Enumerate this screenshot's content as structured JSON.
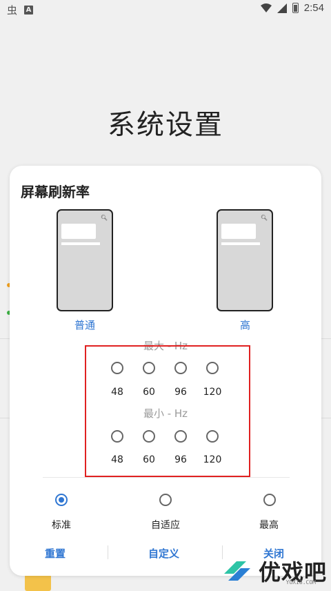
{
  "status_bar": {
    "time": "2:54",
    "left_icon_char": "虫",
    "a_icon": "A"
  },
  "page_title": "系统设置",
  "dialog": {
    "title": "屏幕刷新率",
    "options": [
      {
        "label": "普通"
      },
      {
        "label": "高"
      }
    ],
    "max_label": "最大 - Hz",
    "min_label": "最小 - Hz",
    "max_values": [
      "48",
      "60",
      "96",
      "120"
    ],
    "min_values": [
      "48",
      "60",
      "96",
      "120"
    ],
    "modes": [
      {
        "label": "标准",
        "selected": true
      },
      {
        "label": "自适应",
        "selected": false
      },
      {
        "label": "最高",
        "selected": false
      }
    ],
    "buttons": {
      "reset": "重置",
      "custom": "自定义",
      "close": "关闭"
    }
  },
  "watermark": {
    "text": "优戏吧",
    "sub": "YOXI8.COM"
  },
  "colors": {
    "accent": "#2f76d2",
    "highlight": "#e02020"
  }
}
